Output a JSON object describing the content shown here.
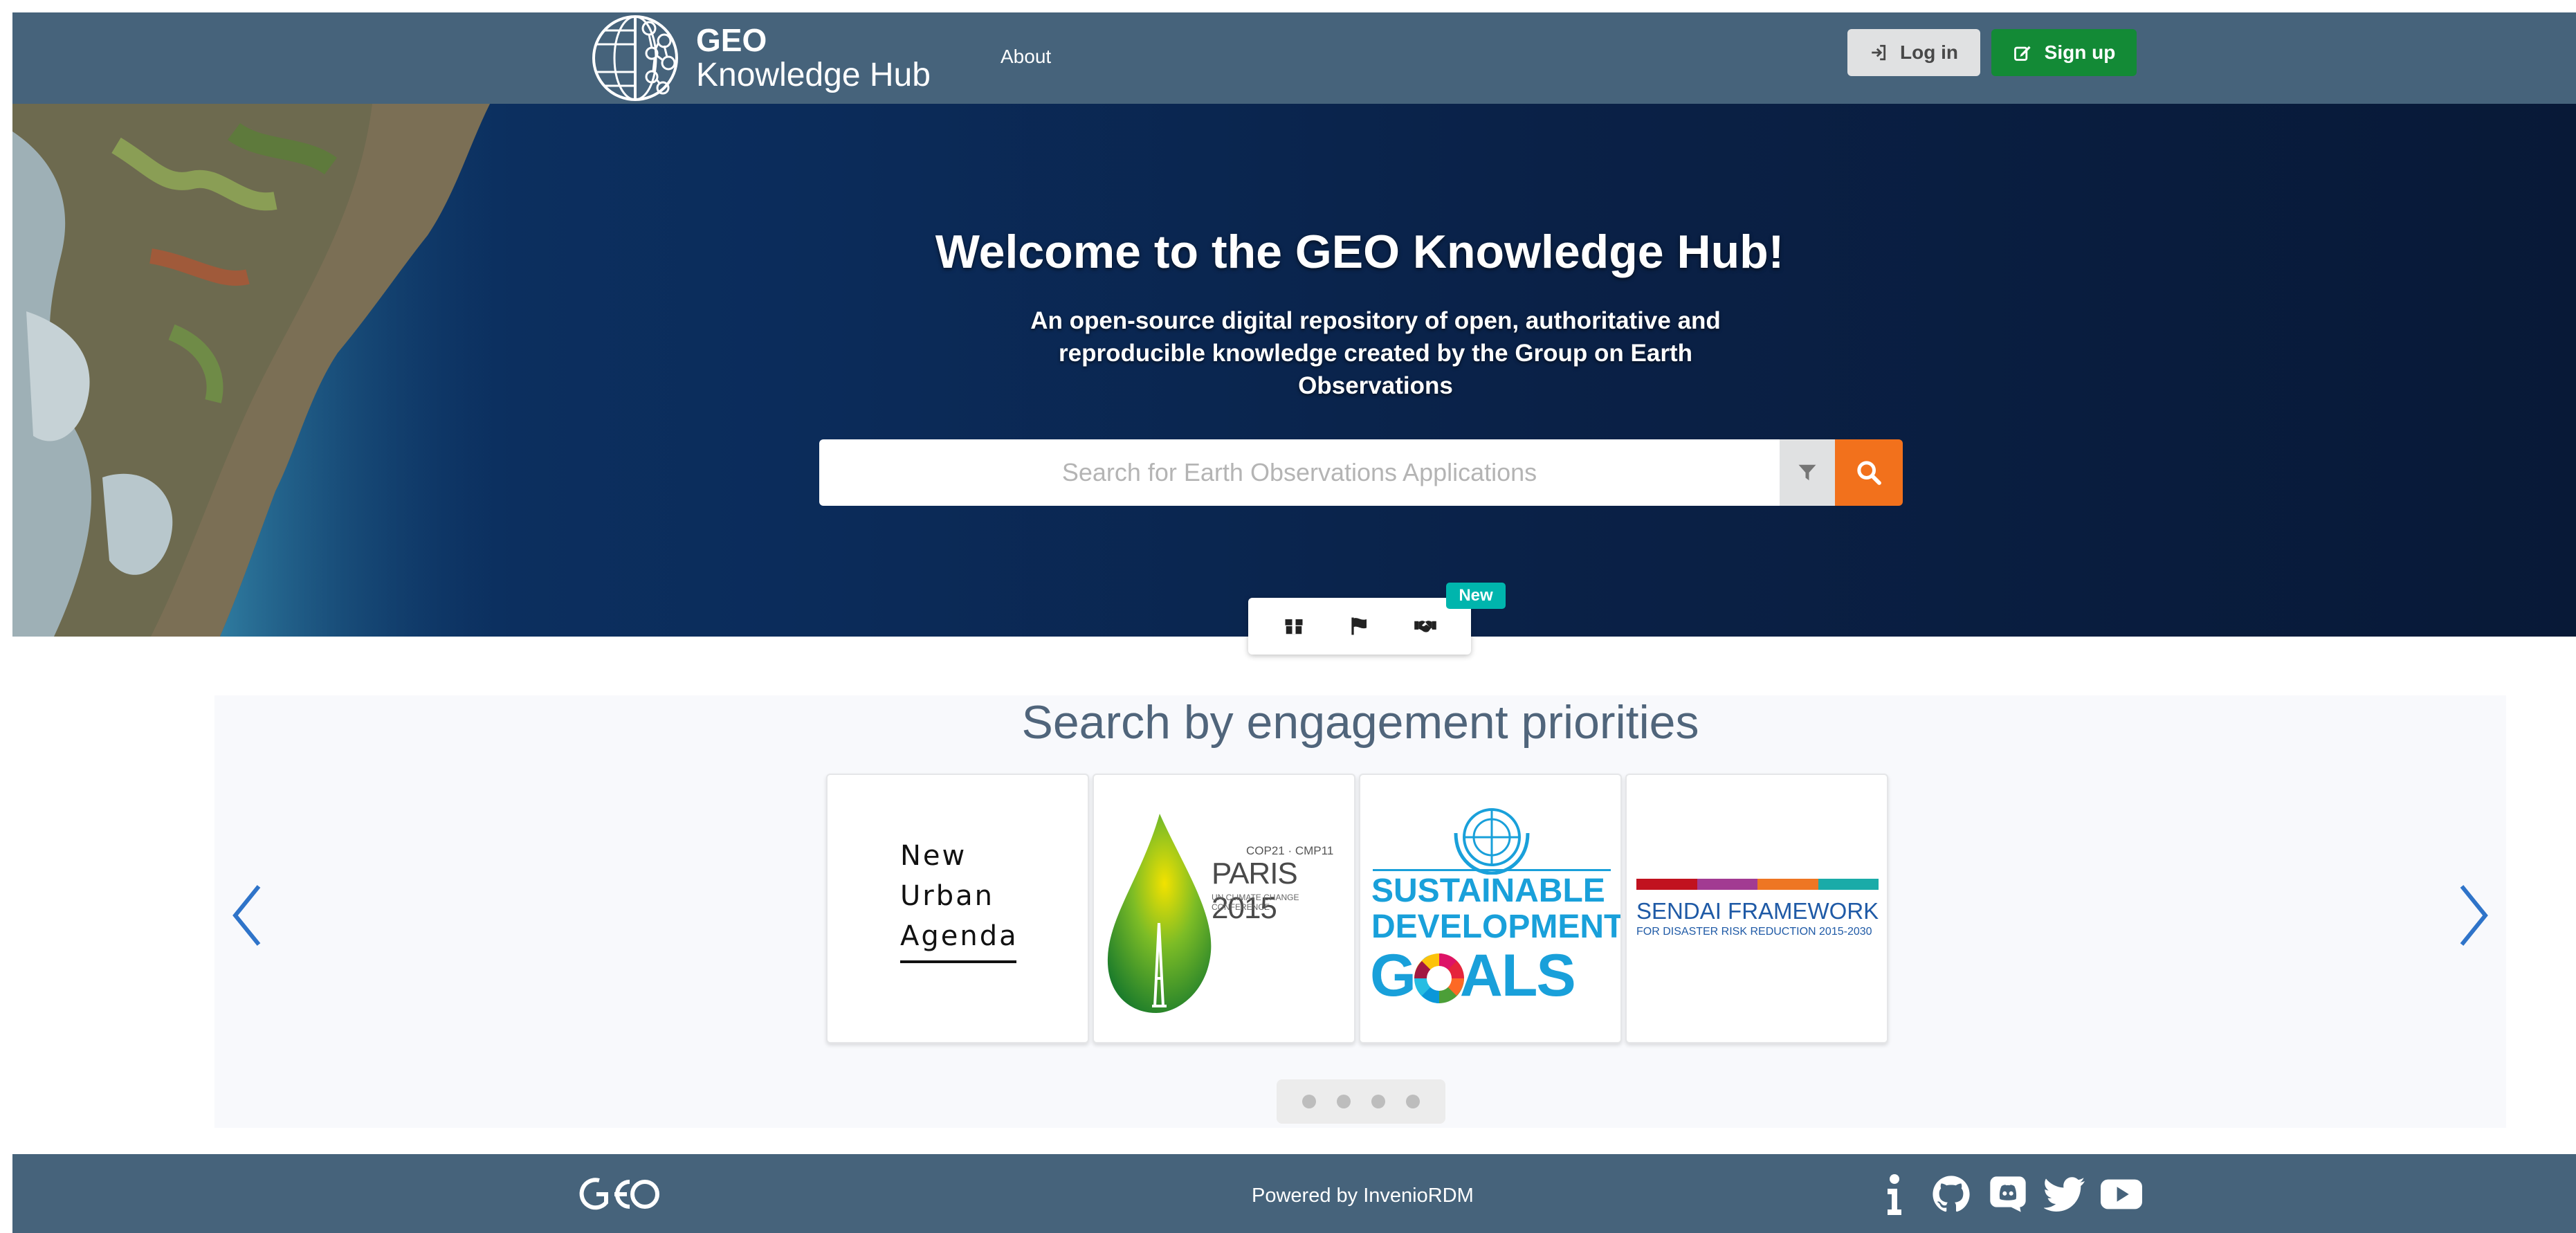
{
  "navbar": {
    "logo_line1": "GEO",
    "logo_line2": "Knowledge Hub",
    "about_label": "About",
    "login_label": "Log in",
    "signup_label": "Sign up"
  },
  "hero": {
    "title": "Welcome to the GEO Knowledge Hub!",
    "subtitle": "An open-source digital repository of open, authoritative and reproducible knowledge created by the Group on Earth Observations",
    "search_placeholder": "Search for Earth Observations Applications",
    "tab_icons": [
      "package-icon",
      "flag-icon",
      "handshake-icon"
    ],
    "new_badge": "New"
  },
  "engagement": {
    "title": "Search by engagement priorities",
    "cards": [
      {
        "name": "new-urban-agenda",
        "lines": [
          "New",
          "Urban",
          "Agenda"
        ]
      },
      {
        "name": "paris-2015",
        "top": "COP21 · CMP11",
        "main": "PARIS 2015",
        "sub": "UN CLIMATE CHANGE CONFERENCE"
      },
      {
        "name": "sustainable-development-goals",
        "lines": [
          "SUSTAINABLE",
          "DEVELOPMENT",
          "GOALS"
        ]
      },
      {
        "name": "sendai-framework",
        "main": "SENDAI FRAMEWORK",
        "sub": "FOR DISASTER RISK REDUCTION 2015-2030"
      }
    ],
    "dot_count": 4
  },
  "footer": {
    "logo_text": "GEO",
    "powered_prefix": "Powered by",
    "powered_link": "InvenioRDM",
    "social_icons": [
      "info-icon",
      "github-icon",
      "discord-icon",
      "twitter-icon",
      "youtube-icon"
    ]
  },
  "colors": {
    "navbar": "#46637b",
    "signup": "#138a36",
    "login": "#e0e1e2",
    "search_button": "#f2711c",
    "badge": "#00b5ad",
    "carousel_arrow": "#2f74c9"
  }
}
